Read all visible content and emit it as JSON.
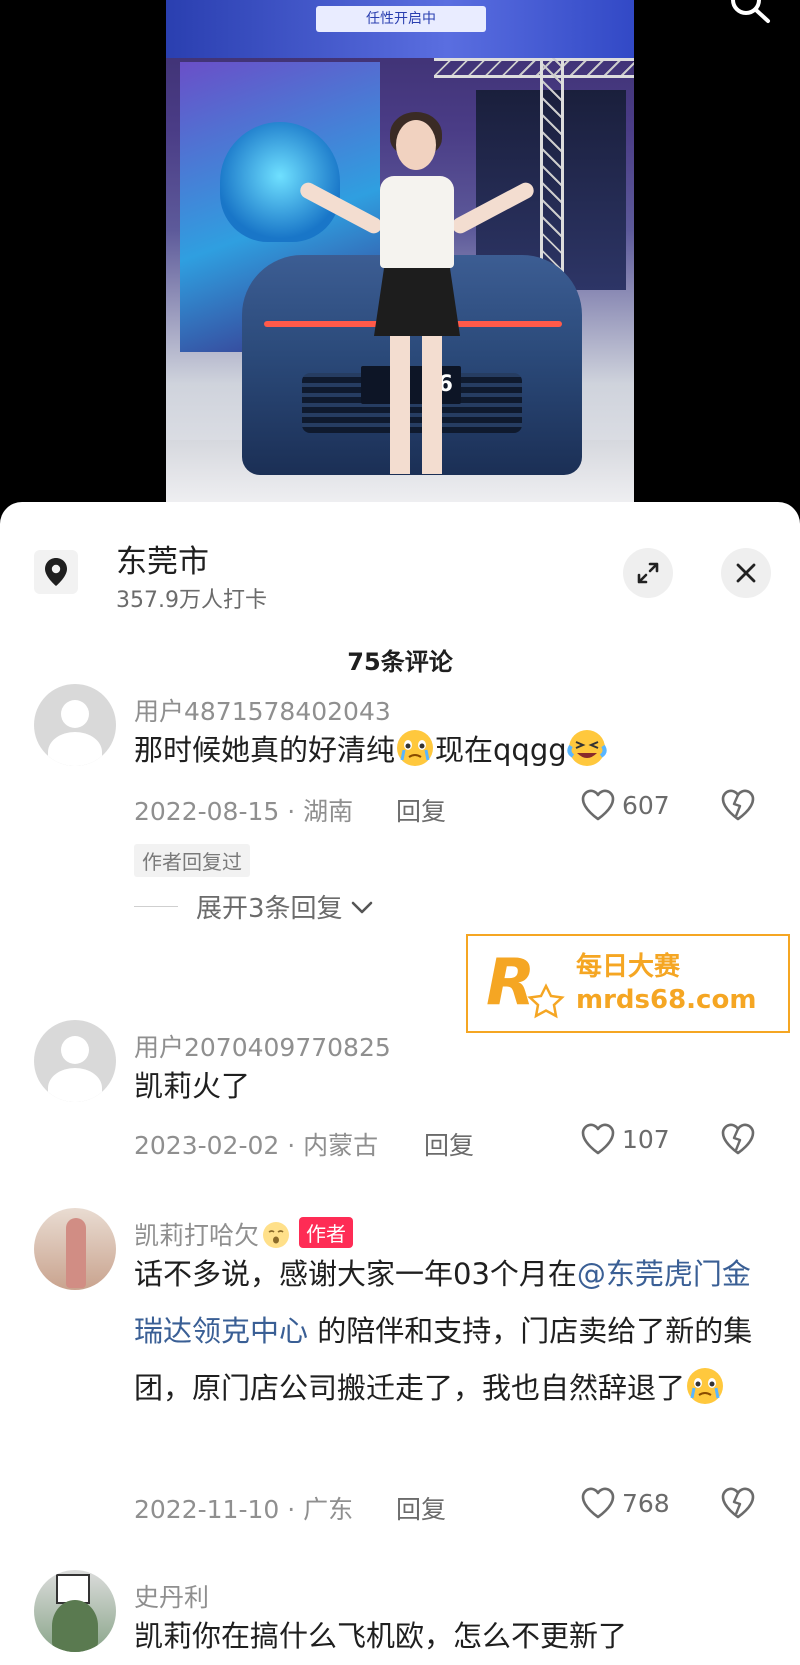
{
  "video": {
    "banner_text": "任性开启中",
    "plate_text": "96"
  },
  "location": {
    "name": "东莞市",
    "checkins": "357.9万人打卡"
  },
  "comments_header": "75条评论",
  "comments": [
    {
      "user": "用户4871578402043",
      "text_before": "那时候她真的好清纯",
      "text_mid": "现在qqgg",
      "date_region": "2022-08-15 · 湖南",
      "reply_label": "回复",
      "likes": "607",
      "author_replied": "作者回复过",
      "expand": "展开3条回复"
    },
    {
      "user": "用户2070409770825",
      "text": "凯莉火了",
      "date_region": "2023-02-02 · 内蒙古",
      "reply_label": "回复",
      "likes": "107"
    },
    {
      "user": "凯莉打哈欠",
      "author_badge": "作者",
      "text_before": "话不多说，感谢大家一年03个月在",
      "mention": "@东莞虎门金瑞达领克中心",
      "text_after": " 的陪伴和支持，门店卖给了新的集团，原门店公司搬迁走了，我也自然辞退了",
      "date_region": "2022-11-10 · 广东",
      "reply_label": "回复",
      "likes": "768"
    },
    {
      "user": "史丹利",
      "text": "凯莉你在搞什么飞机欧，怎么不更新了"
    }
  ],
  "watermark": {
    "line1": "每日大赛",
    "line2": "mrds68.com",
    "color": "#f5a623"
  }
}
